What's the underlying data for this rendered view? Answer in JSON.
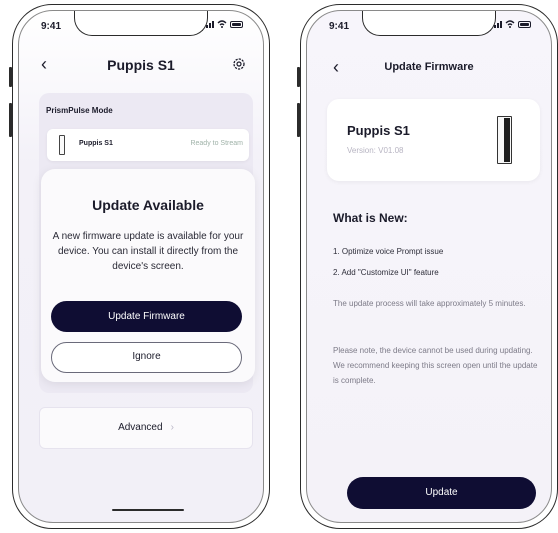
{
  "left_screen": {
    "status_time": "9:41",
    "title": "Puppis S1",
    "mode_title": "PrismPulse Mode",
    "device_name": "Puppis S1",
    "device_status": "Ready to Stream",
    "modal_title": "Update Available",
    "modal_text": "A new firmware update is available for your device. You can install it directly from the device's screen.",
    "update_button": "Update Firmware",
    "ignore_button": "Ignore",
    "advanced_label": "Advanced"
  },
  "right_screen": {
    "status_time": "9:41",
    "title": "Update Firmware",
    "device_name": "Puppis S1",
    "device_version": "Version: V01.08",
    "section_title": "What is New:",
    "item_1": "1. Optimize voice Prompt issue",
    "item_2": "2. Add \"Customize UI\" feature",
    "duration_note": "The update process will take approximately 5 minutes.",
    "warning_note": "Please note, the device cannot be used during updating. We recommend keeping this screen open until the update is complete.",
    "update_button": "Update"
  },
  "icons": [
    "back-chevron-icon",
    "gear-icon",
    "signal-icon",
    "wifi-icon",
    "battery-icon",
    "chevron-right-icon"
  ],
  "colors": {
    "primary_button": "#0f0d33",
    "status_text": "#9fb2a8"
  }
}
